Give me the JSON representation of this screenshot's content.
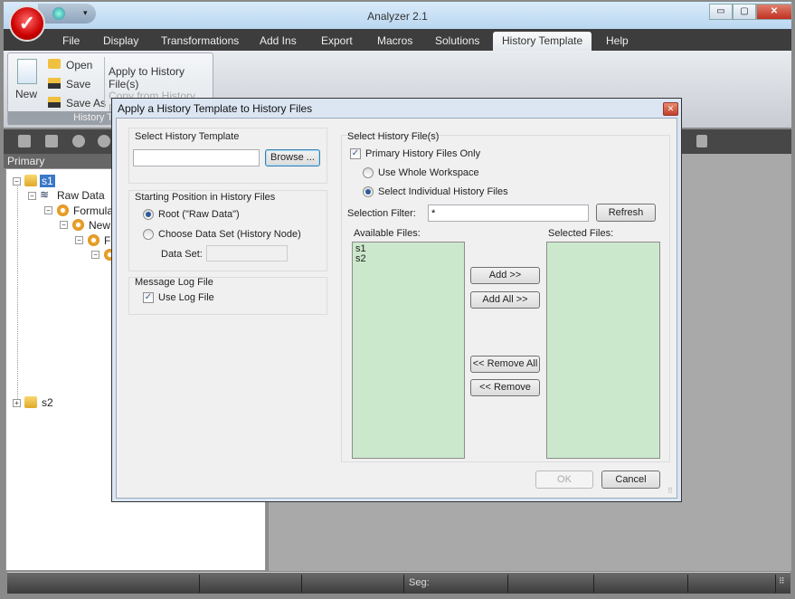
{
  "app": {
    "title": "Analyzer 2.1",
    "window_buttons": [
      "minimize",
      "maximize",
      "close"
    ]
  },
  "menu": {
    "items": [
      "File",
      "Display",
      "Transformations",
      "Add Ins",
      "Export",
      "Macros",
      "Solutions",
      "History Template",
      "Help"
    ],
    "active": "History Template"
  },
  "ribbon": {
    "new": "New",
    "open": "Open",
    "save": "Save",
    "save_as": "Save As",
    "apply": "Apply to History File(s)",
    "copy": "Copy from History File",
    "group": "History Template"
  },
  "panel": {
    "header": "Primary"
  },
  "tree": {
    "s1": "s1",
    "raw": "Raw Data",
    "formula": "Formula",
    "new": "New",
    "f": "Fi",
    "s2": "s2"
  },
  "status": {
    "seg": "Seg:"
  },
  "dialog": {
    "title": "Apply a History Template to History Files",
    "template_group": "Select History Template",
    "template_value": "",
    "browse": "Browse ...",
    "start_group": "Starting Position in History Files",
    "root": "Root (\"Raw Data\")",
    "root_selected": true,
    "choose": "Choose Data Set (History Node)",
    "dataset_label": "Data Set:",
    "dataset_value": "",
    "log_group": "Message Log File",
    "use_log": "Use Log File",
    "use_log_checked": true,
    "files_group": "Select History File(s)",
    "primary_only": "Primary History Files Only",
    "primary_only_checked": true,
    "whole": "Use Whole Workspace",
    "individual": "Select Individual History Files",
    "individual_selected": true,
    "filter_label": "Selection Filter:",
    "filter_value": "*",
    "refresh": "Refresh",
    "available_label": "Available Files:",
    "available": [
      "s1",
      "s2"
    ],
    "selected_label": "Selected Files:",
    "selected": [],
    "add": "Add >>",
    "add_all": "Add All >>",
    "remove_all": "<< Remove All",
    "remove": "<< Remove",
    "ok": "OK",
    "cancel": "Cancel"
  }
}
